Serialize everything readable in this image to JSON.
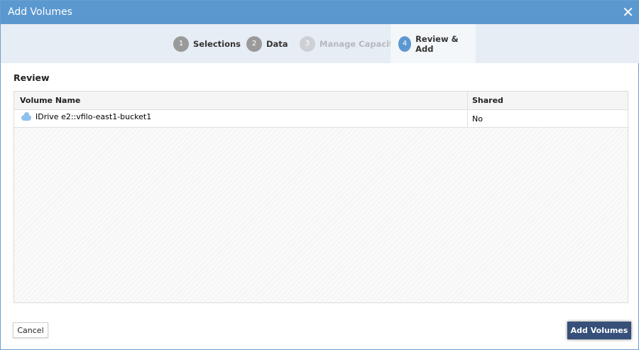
{
  "dialog": {
    "title": "Add Volumes",
    "close_icon": "close-icon"
  },
  "steps": [
    {
      "num": "1",
      "label": "Selections",
      "state": "done"
    },
    {
      "num": "2",
      "label": "Data",
      "state": "done"
    },
    {
      "num": "3",
      "label": "Manage Capacity",
      "state": "disabled"
    },
    {
      "num": "4",
      "label": "Review & Add",
      "state": "active"
    }
  ],
  "review": {
    "title": "Review",
    "columns": [
      "Volume Name",
      "Shared"
    ],
    "rows": [
      {
        "name": "IDrive e2::vfilo-east1-bucket1",
        "shared": "No",
        "icon": "cloud-icon"
      }
    ]
  },
  "buttons": {
    "cancel": "Cancel",
    "add": "Add Volumes"
  },
  "colors": {
    "accent": "#5b98d0",
    "primary_button": "#37507a"
  }
}
